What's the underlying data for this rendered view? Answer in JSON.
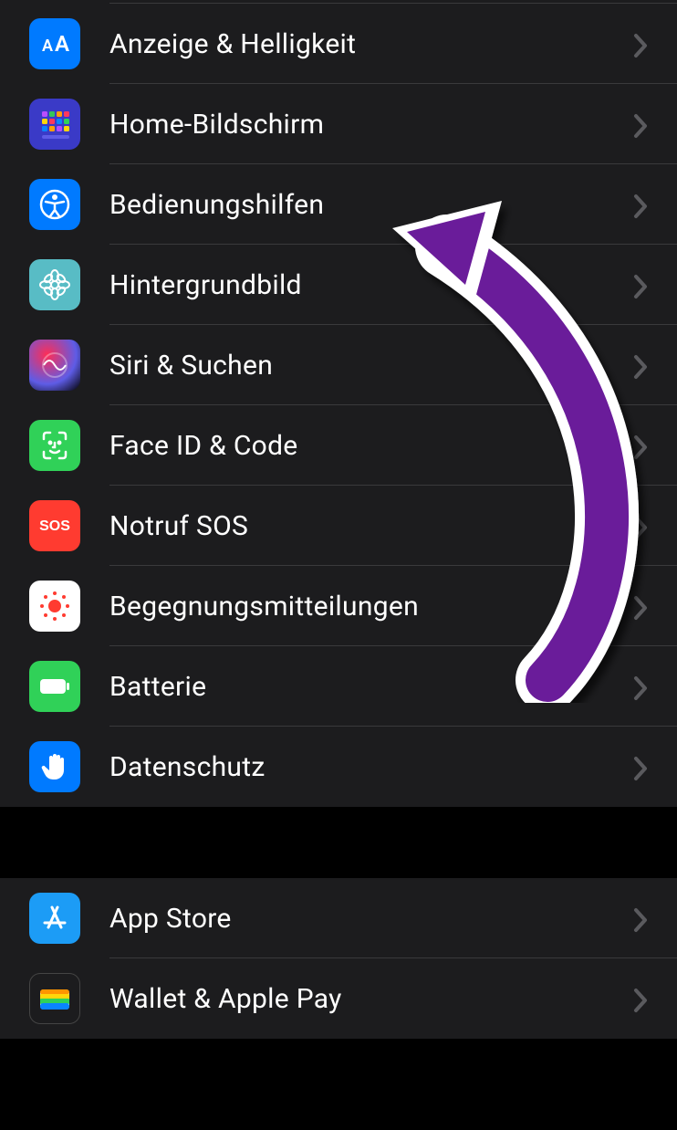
{
  "sections": [
    {
      "id": "general",
      "items": [
        {
          "key": "display",
          "label": "Anzeige & Helligkeit",
          "icon": "text-size-icon",
          "bg": "bg-blue"
        },
        {
          "key": "home-screen",
          "label": "Home-Bildschirm",
          "icon": "home-grid-icon",
          "bg": "bg-indigo"
        },
        {
          "key": "accessibility",
          "label": "Bedienungshilfen",
          "icon": "accessibility-icon",
          "bg": "bg-blue"
        },
        {
          "key": "wallpaper",
          "label": "Hintergrundbild",
          "icon": "flower-icon",
          "bg": "bg-teal"
        },
        {
          "key": "siri",
          "label": "Siri & Suchen",
          "icon": "siri-icon",
          "bg": "bg-grad"
        },
        {
          "key": "faceid",
          "label": "Face ID & Code",
          "icon": "faceid-icon",
          "bg": "bg-green"
        },
        {
          "key": "sos",
          "label": "Notruf SOS",
          "icon": "sos-icon",
          "bg": "bg-red"
        },
        {
          "key": "exposure",
          "label": "Begegnungsmitteilungen",
          "icon": "exposure-icon",
          "bg": "bg-white"
        },
        {
          "key": "battery",
          "label": "Batterie",
          "icon": "battery-icon",
          "bg": "bg-green"
        },
        {
          "key": "privacy",
          "label": "Datenschutz",
          "icon": "hand-icon",
          "bg": "bg-blue"
        }
      ]
    },
    {
      "id": "store",
      "items": [
        {
          "key": "appstore",
          "label": "App Store",
          "icon": "appstore-icon",
          "bg": "bg-blue"
        },
        {
          "key": "wallet",
          "label": "Wallet & Apple Pay",
          "icon": "wallet-icon",
          "bg": "bg-black"
        }
      ]
    }
  ],
  "annotation": {
    "arrow_color": "#6a1b9a"
  }
}
